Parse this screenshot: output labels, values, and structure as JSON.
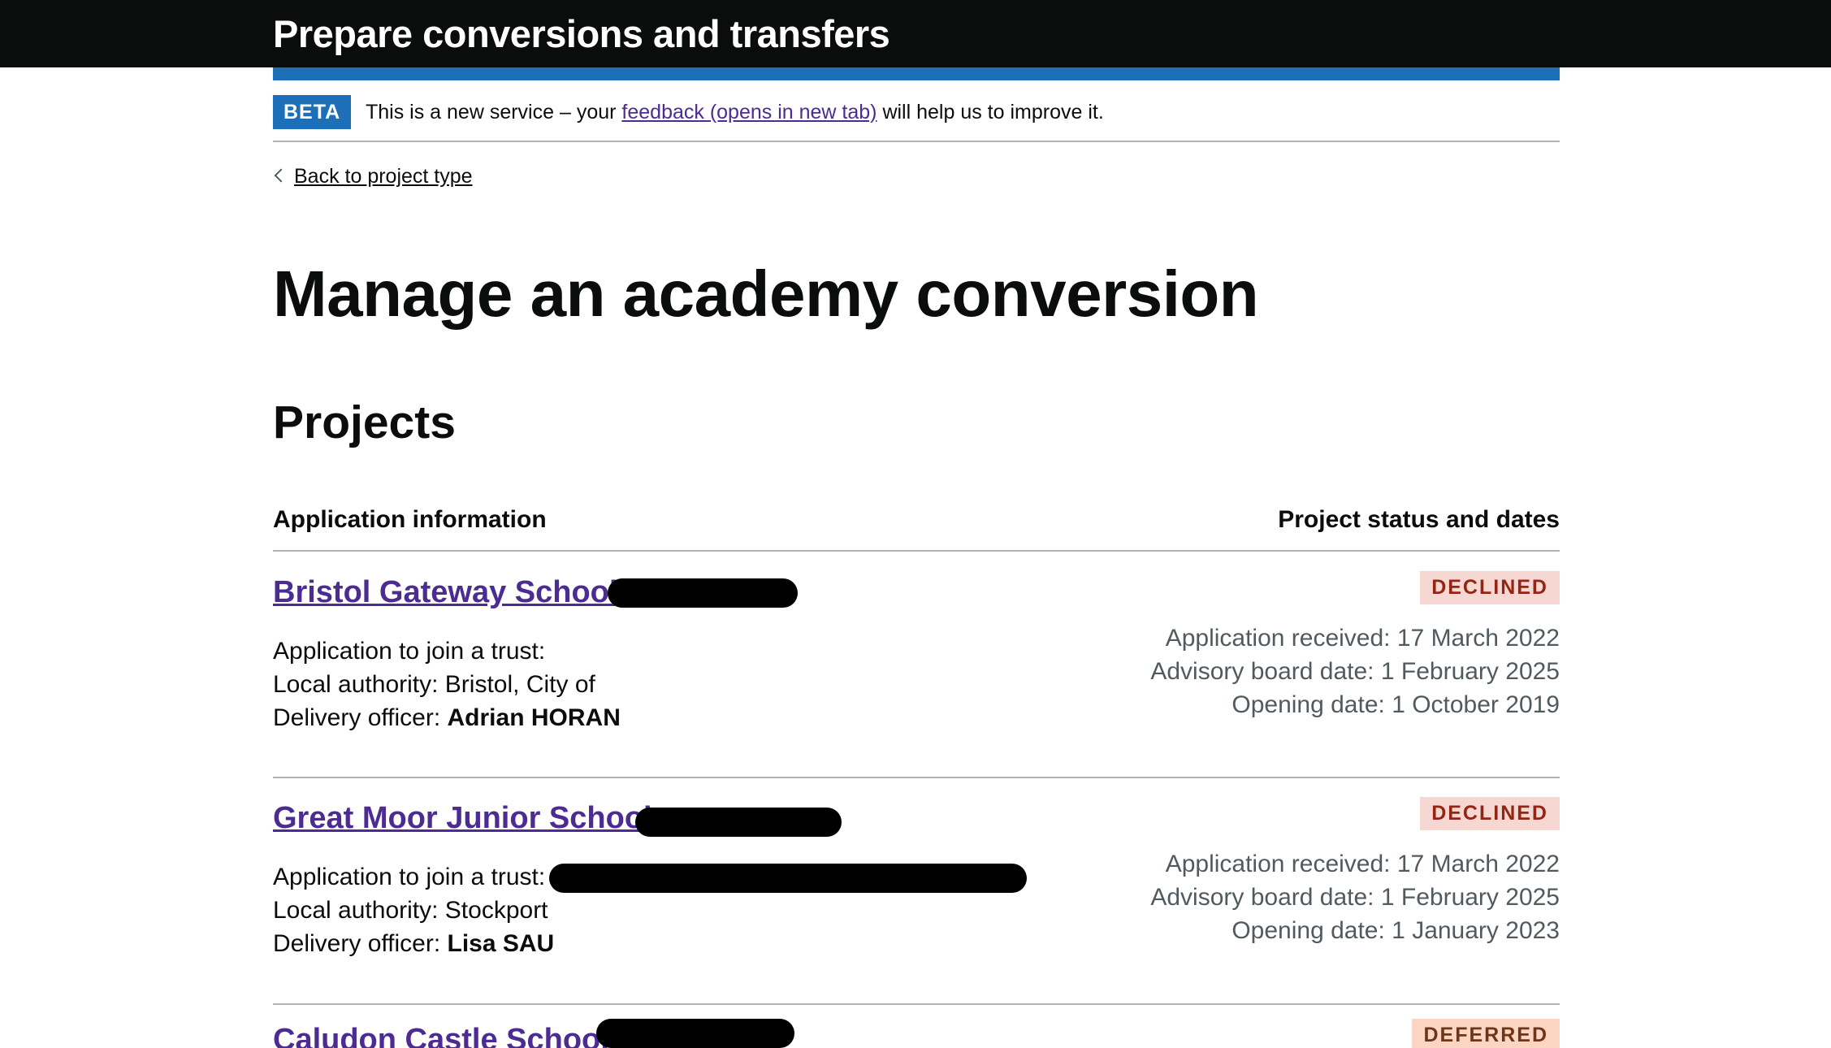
{
  "header": {
    "service_name": "Prepare conversions and transfers"
  },
  "phase_banner": {
    "tag": "BETA",
    "text_before": "This is a new service – your ",
    "link": "feedback (opens in new tab)",
    "text_after": " will help us to improve it."
  },
  "back_link": "Back to project type",
  "page_title": "Manage an academy conversion",
  "section_title": "Projects",
  "table_headers": {
    "left": "Application information",
    "right": "Project status and dates"
  },
  "labels": {
    "application": "Application to join a trust:",
    "local_authority": "Local authority: ",
    "delivery_officer": "Delivery officer: ",
    "application_received": "Application received: ",
    "advisory_board_date": "Advisory board date: ",
    "opening_date": "Opening date: "
  },
  "projects": [
    {
      "name": "Bristol Gateway School",
      "status": "DECLINED",
      "local_authority": "Bristol, City of",
      "delivery_officer": "Adrian HORAN",
      "application_received": "17 March 2022",
      "advisory_board_date": "1 February 2025",
      "opening_date": "1 October 2019"
    },
    {
      "name": "Great Moor Junior School",
      "status": "DECLINED",
      "local_authority": "Stockport",
      "delivery_officer": "Lisa SAU",
      "application_received": "17 March 2022",
      "advisory_board_date": "1 February 2025",
      "opening_date": "1 January 2023"
    },
    {
      "name": "Caludon Castle School",
      "status": "DEFERRED"
    }
  ],
  "colors": {
    "header_bg": "#0b0c0c",
    "brand_blue": "#1d70b8",
    "link_purple": "#4c2c92",
    "secondary_text": "#505a5f",
    "declined_bg": "#f6d7d2",
    "declined_text": "#942514",
    "deferred_bg": "#fcd6c3",
    "deferred_text": "#6e3619"
  }
}
